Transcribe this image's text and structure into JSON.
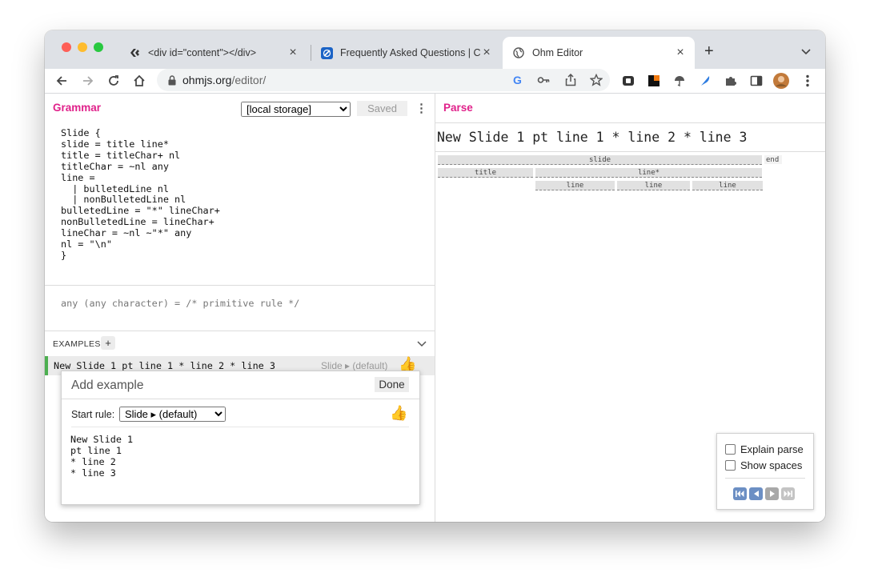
{
  "browser": {
    "tabs": [
      {
        "title": "<div id=\"content\"></div>",
        "active": false
      },
      {
        "title": "Frequently Asked Questions | C",
        "active": false
      },
      {
        "title": "Ohm Editor",
        "active": true
      }
    ],
    "new_tab": "+",
    "url_host": "ohmjs.org",
    "url_path": "/editor/"
  },
  "grammar": {
    "title": "Grammar",
    "storage_selected": "[local storage]",
    "saved_label": "Saved",
    "code": "Slide {\nslide = title line*\ntitle = titleChar+ nl\ntitleChar = ~nl any\nline =\n  | bulletedLine nl\n  | nonBulletedLine nl\nbulletedLine = \"*\" lineChar+\nnonBulletedLine = lineChar+\nlineChar = ~nl ~\"*\" any\nnl = \"\\n\"\n}",
    "rule_info": "any (any character) = /* primitive rule */"
  },
  "examples": {
    "label": "EXAMPLES",
    "add": "+",
    "item": {
      "text": "New Slide 1 pt line 1 * line 2 * line 3",
      "rule": "Slide ▸ (default)"
    },
    "add_panel": {
      "title": "Add example",
      "done": "Done",
      "start_rule_label": "Start rule:",
      "start_rule_selected": "Slide ▸ (default)",
      "input": "New Slide 1\npt line 1\n* line 2\n* line 3"
    }
  },
  "parse": {
    "title": "Parse",
    "input": "New Slide 1 pt line 1 * line 2 * line 3",
    "tree": {
      "root": "slide",
      "end": "end",
      "title": "title",
      "line_star": "line*",
      "lines": [
        "line",
        "line",
        "line"
      ]
    },
    "options": {
      "explain_parse": "Explain parse",
      "show_spaces": "Show spaces",
      "explain_checked": false,
      "spaces_checked": false
    }
  }
}
